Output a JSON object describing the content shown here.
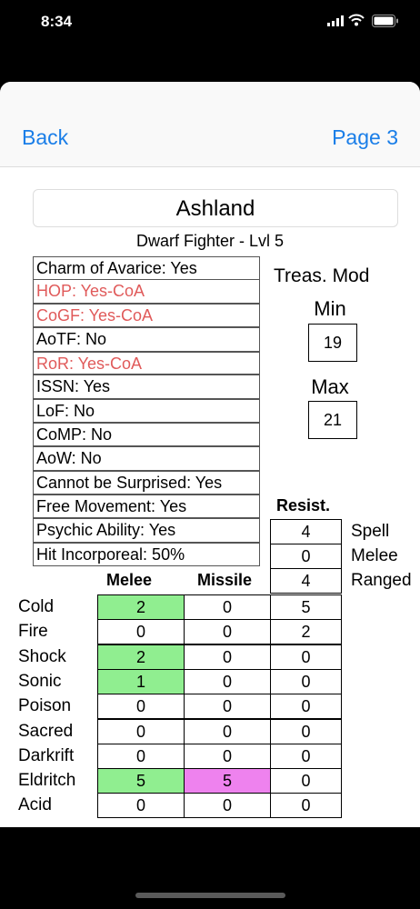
{
  "status": {
    "time": "8:34"
  },
  "nav": {
    "back_label": "Back",
    "page_label": "Page 3"
  },
  "character": {
    "name": "Ashland",
    "subtitle": "Dwarf Fighter - Lvl 5"
  },
  "items": [
    {
      "text": "Charm of Avarice: Yes",
      "highlight": false
    },
    {
      "text": "HOP: Yes-CoA",
      "highlight": true
    },
    {
      "text": "CoGF: Yes-CoA",
      "highlight": true
    },
    {
      "text": "AoTF: No",
      "highlight": false
    },
    {
      "text": "RoR: Yes-CoA",
      "highlight": true
    },
    {
      "text": "ISSN: Yes",
      "highlight": false
    },
    {
      "text": "LoF: No",
      "highlight": false
    },
    {
      "text": "CoMP: No",
      "highlight": false
    },
    {
      "text": "AoW: No",
      "highlight": false
    },
    {
      "text": "Cannot be Surprised: Yes",
      "highlight": false
    },
    {
      "text": "Free Movement: Yes",
      "highlight": false
    },
    {
      "text": "Psychic Ability: Yes",
      "highlight": false
    },
    {
      "text": "Hit Incorporeal: 50%",
      "highlight": false
    }
  ],
  "treasure": {
    "label": "Treas. Mod",
    "min_label": "Min",
    "min_value": "19",
    "max_label": "Max",
    "max_value": "21"
  },
  "resist": {
    "header": "Resist.",
    "rows": [
      {
        "label": "Spell",
        "value": "4"
      },
      {
        "label": "Melee",
        "value": "0"
      },
      {
        "label": "Ranged",
        "value": "4"
      }
    ]
  },
  "damage": {
    "melee_header": "Melee",
    "missile_header": "Missile",
    "rows": [
      {
        "type": "Cold",
        "melee": "2",
        "missile": "0",
        "resist": "5",
        "melee_hl": "green",
        "missile_hl": ""
      },
      {
        "type": "Fire",
        "melee": "0",
        "missile": "0",
        "resist": "2",
        "melee_hl": "",
        "missile_hl": ""
      },
      {
        "type": "Shock",
        "melee": "2",
        "missile": "0",
        "resist": "0",
        "melee_hl": "green",
        "missile_hl": ""
      },
      {
        "type": "Sonic",
        "melee": "1",
        "missile": "0",
        "resist": "0",
        "melee_hl": "green",
        "missile_hl": ""
      },
      {
        "type": "Poison",
        "melee": "0",
        "missile": "0",
        "resist": "0",
        "melee_hl": "",
        "missile_hl": ""
      },
      {
        "type": "Sacred",
        "melee": "0",
        "missile": "0",
        "resist": "0",
        "melee_hl": "",
        "missile_hl": ""
      },
      {
        "type": "Darkrift",
        "melee": "0",
        "missile": "0",
        "resist": "0",
        "melee_hl": "",
        "missile_hl": ""
      },
      {
        "type": "Eldritch",
        "melee": "5",
        "missile": "5",
        "resist": "0",
        "melee_hl": "green",
        "missile_hl": "pink"
      },
      {
        "type": "Acid",
        "melee": "0",
        "missile": "0",
        "resist": "0",
        "melee_hl": "",
        "missile_hl": ""
      }
    ]
  }
}
